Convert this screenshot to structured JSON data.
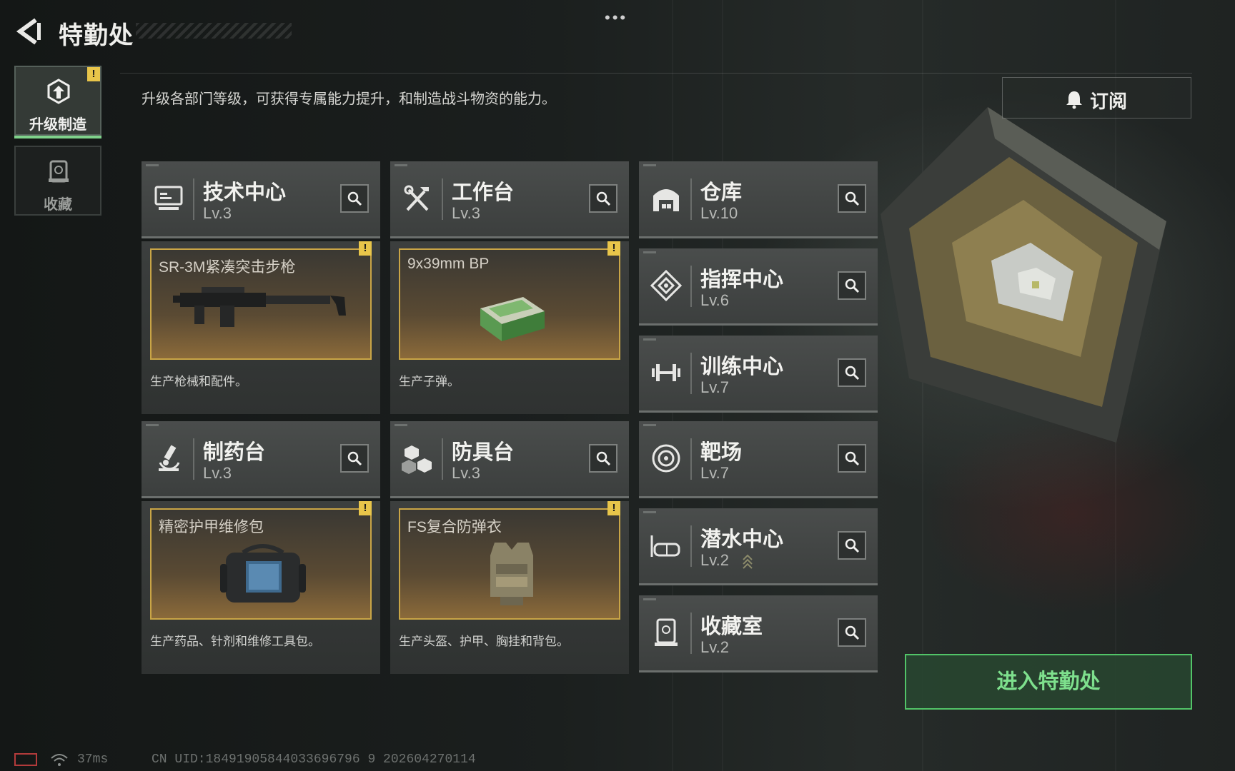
{
  "header": {
    "title": "特勤处",
    "subtitle": "升级各部门等级，可获得专属能力提升，和制造战斗物资的能力。",
    "more_label": "•••"
  },
  "nav": {
    "tabs": [
      {
        "label": "升级制造",
        "active": true,
        "alert": "!"
      },
      {
        "label": "收藏",
        "active": false
      }
    ]
  },
  "subscribe": {
    "label": "订阅"
  },
  "departments": [
    {
      "name": "技术中心",
      "level": "Lv.3",
      "icon": "monitor-icon"
    },
    {
      "name": "工作台",
      "level": "Lv.3",
      "icon": "tools-icon"
    },
    {
      "name": "仓库",
      "level": "Lv.10",
      "icon": "garage-icon"
    },
    {
      "name": "指挥中心",
      "level": "Lv.6",
      "icon": "command-icon"
    },
    {
      "name": "训练中心",
      "level": "Lv.7",
      "icon": "dumbbell-icon"
    },
    {
      "name": "制药台",
      "level": "Lv.3",
      "icon": "microscope-icon"
    },
    {
      "name": "防具台",
      "level": "Lv.3",
      "icon": "boxes-icon"
    },
    {
      "name": "靶场",
      "level": "Lv.7",
      "icon": "target-icon"
    },
    {
      "name": "潜水中心",
      "level": "Lv.2",
      "icon": "diving-mask-icon",
      "upgradable": true
    },
    {
      "name": "收藏室",
      "level": "Lv.2",
      "icon": "collection-icon"
    }
  ],
  "products": [
    {
      "name": "SR-3M紧凑突击步枪",
      "description": "生产枪械和配件。",
      "alert": "!",
      "image": "rifle-image"
    },
    {
      "name": "9x39mm BP",
      "description": "生产子弹。",
      "alert": "!",
      "image": "ammo-box-image"
    },
    {
      "name": "精密护甲维修包",
      "description": "生产药品、针剂和维修工具包。",
      "alert": "!",
      "image": "repair-bag-image"
    },
    {
      "name": "FS复合防弹衣",
      "description": "生产头盔、护甲、胸挂和背包。",
      "alert": "!",
      "image": "body-armor-image"
    }
  ],
  "enter_button": {
    "label": "进入特勤处"
  },
  "footer": {
    "latency": "37ms",
    "uid": "CN UID:18491905844033696796 9 202604270114"
  },
  "colors": {
    "accent_green": "#52c468",
    "alert_yellow": "#e8c54a",
    "frame_gold": "#c9a546"
  }
}
